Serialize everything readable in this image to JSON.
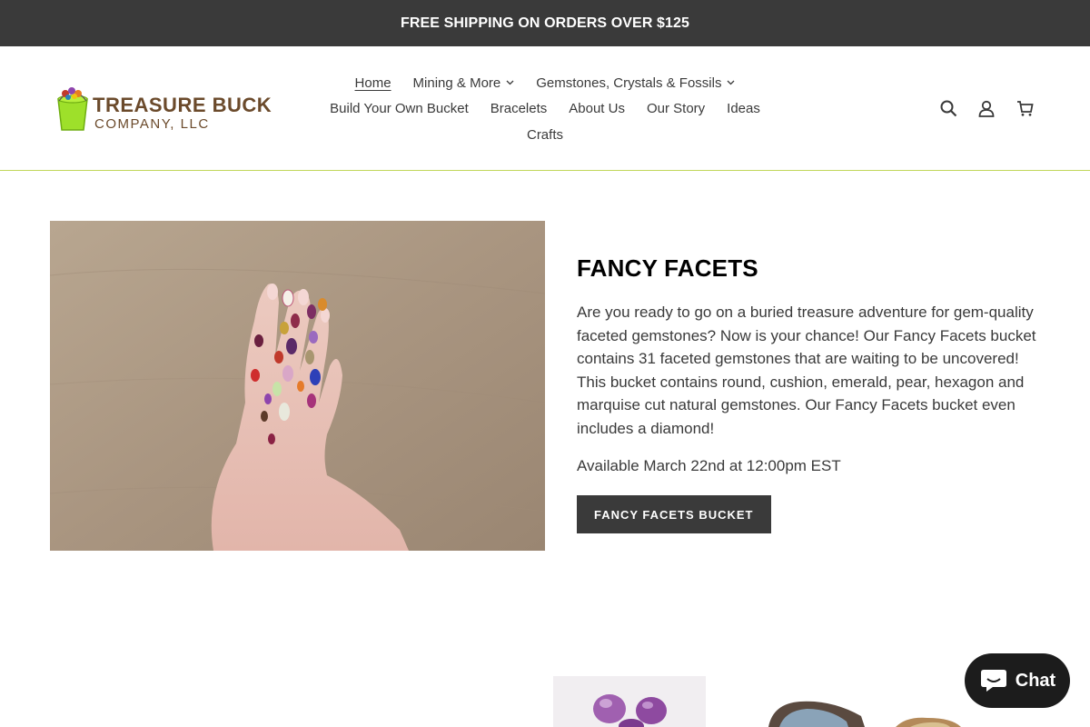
{
  "announcement": {
    "text": "FREE SHIPPING ON ORDERS OVER $125"
  },
  "brand": {
    "logo_line1": "TREASURE BUCKETS",
    "logo_line2": "COMPANY, LLC"
  },
  "nav": {
    "row1": [
      {
        "label": "Home",
        "active": true
      },
      {
        "label": "Mining & More",
        "dropdown": true
      },
      {
        "label": "Gemstones, Crystals & Fossils",
        "dropdown": true
      }
    ],
    "row2": [
      {
        "label": "Build Your Own Bucket"
      },
      {
        "label": "Bracelets"
      },
      {
        "label": "About Us"
      },
      {
        "label": "Our Story"
      },
      {
        "label": "Ideas"
      }
    ],
    "row3": [
      {
        "label": "Crafts"
      }
    ]
  },
  "header_icons": [
    "search-icon",
    "account-icon",
    "cart-icon"
  ],
  "feature": {
    "title": "FANCY FACETS",
    "description": "Are you ready to go on a buried treasure adventure for gem-quality faceted gemstones? Now is your chance! Our Fancy Facets bucket contains 31 faceted gemstones that are waiting to be uncovered! This bucket contains round, cushion, emerald, pear, hexagon and marquise cut natural gemstones. Our Fancy Facets bucket even includes a diamond!",
    "availability": "Available March 22nd at 12:00pm EST",
    "button_label": "FANCY FACETS BUCKET"
  },
  "chat": {
    "label": "Chat"
  },
  "colors": {
    "dark": "#3a3a3a",
    "accent_border": "#c1d65a",
    "chat_bg": "#1c1c1c"
  }
}
